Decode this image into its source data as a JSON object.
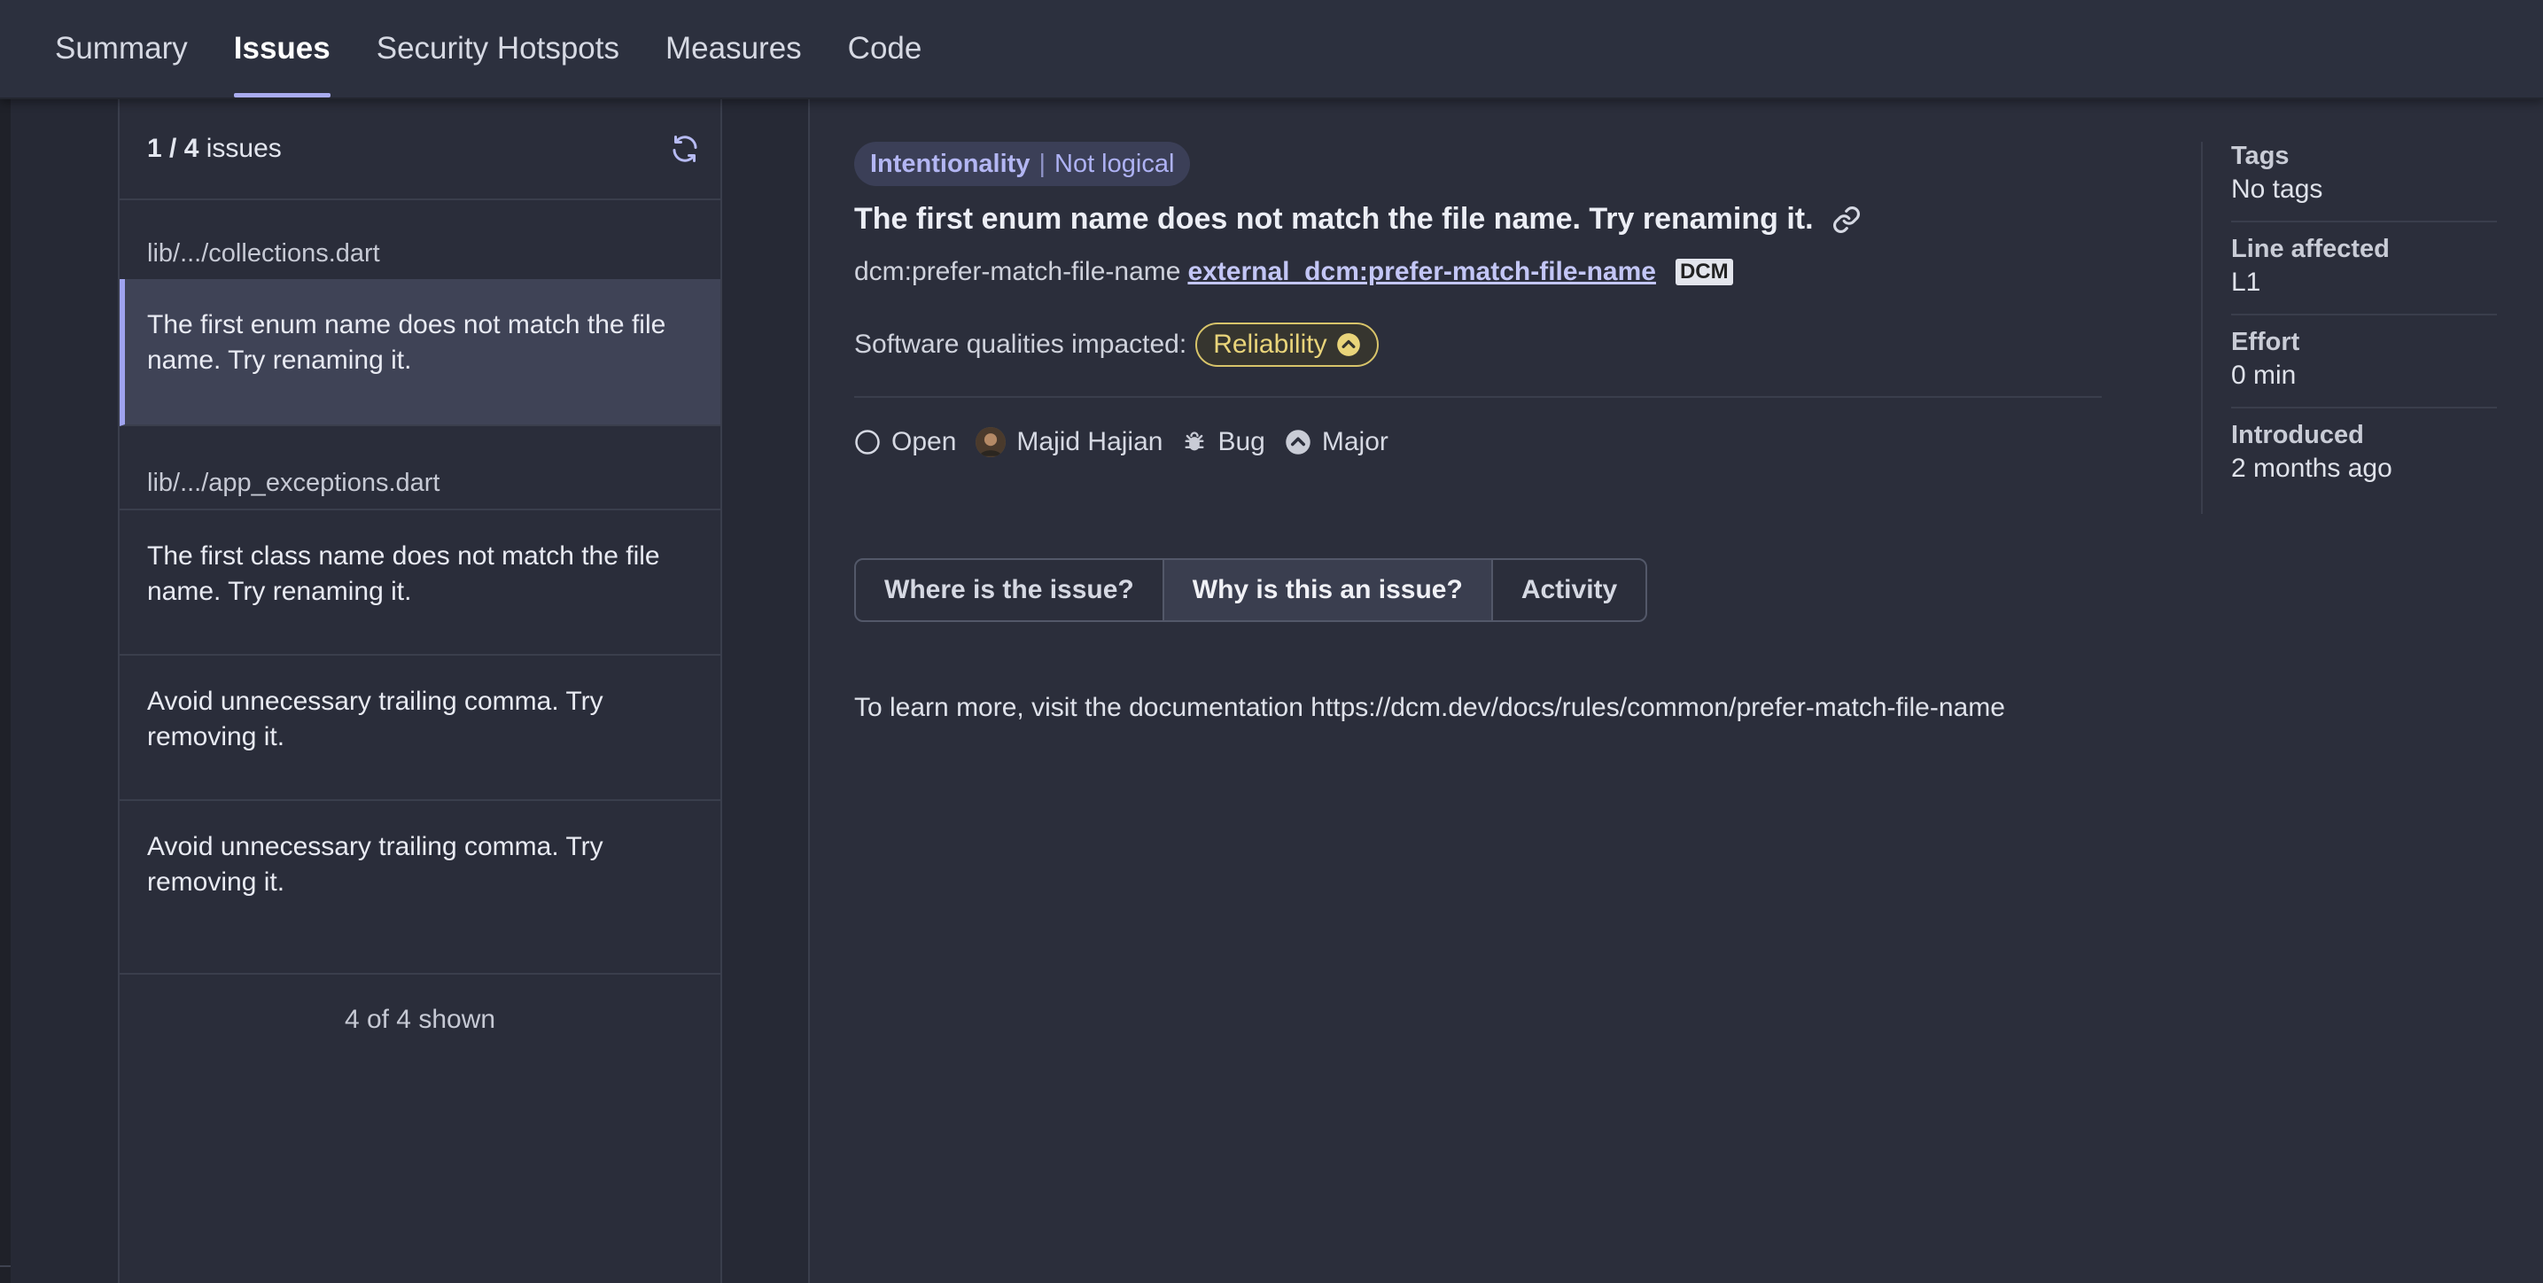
{
  "nav": {
    "tabs": [
      "Summary",
      "Issues",
      "Security Hotspots",
      "Measures",
      "Code"
    ],
    "active": "Issues"
  },
  "list": {
    "count_current": "1",
    "count_total": "4",
    "count_suffix": "issues",
    "groups": [
      {
        "file": "lib/.../collections.dart",
        "issues": [
          "The first enum name does not match the file name. Try renaming it."
        ]
      },
      {
        "file": "lib/.../app_exceptions.dart",
        "issues": [
          "The first class name does not match the file name. Try renaming it.",
          "Avoid unnecessary trailing comma. Try removing it.",
          "Avoid unnecessary trailing comma. Try removing it."
        ]
      }
    ],
    "shown": "4 of 4 shown"
  },
  "issue": {
    "attribute": "Intentionality",
    "attribute_value": "Not logical",
    "title": "The first enum name does not match the file name. Try renaming it.",
    "rule_key": "dcm:prefer-match-file-name",
    "rule_link": "external_dcm:prefer-match-file-name",
    "engine_tag": "DCM",
    "qualities_label": "Software qualities impacted:",
    "quality": "Reliability",
    "status": "Open",
    "assignee": "Majid Hajian",
    "type": "Bug",
    "severity": "Major",
    "tabs": [
      "Where is the issue?",
      "Why is this an issue?",
      "Activity"
    ],
    "active_tab": "Why is this an issue?",
    "description": "To learn more, visit the documentation https://dcm.dev/docs/rules/common/prefer-match-file-name"
  },
  "sidebar": {
    "tags_label": "Tags",
    "tags_value": "No tags",
    "line_label": "Line affected",
    "line_value": "L1",
    "effort_label": "Effort",
    "effort_value": "0 min",
    "introduced_label": "Introduced",
    "introduced_value": "2 months ago"
  },
  "colors": {
    "accent": "#a9acf0",
    "reliability": "#e9d47a",
    "background": "#2b2e3b"
  }
}
